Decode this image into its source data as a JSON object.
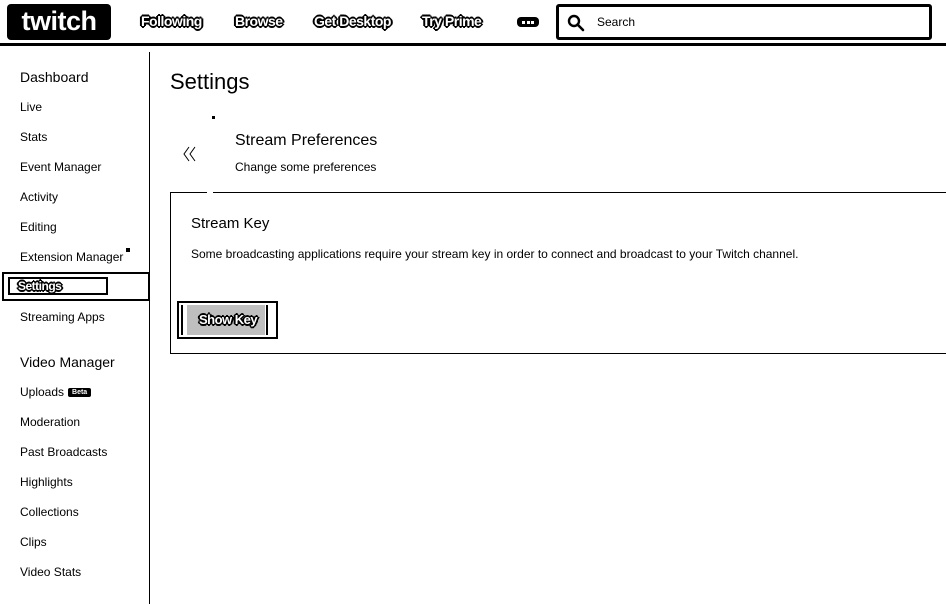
{
  "header": {
    "logo_text": "twitch",
    "nav": [
      {
        "label": "Following"
      },
      {
        "label": "Browse"
      },
      {
        "label": "Get Desktop"
      },
      {
        "label": "Try Prime"
      }
    ],
    "more_icon": "ellipsis-icon",
    "search": {
      "placeholder": "Search",
      "icon": "search-icon"
    }
  },
  "sidebar": {
    "dashboard_heading": "Dashboard",
    "dashboard_items": [
      {
        "label": "Live"
      },
      {
        "label": "Stats"
      },
      {
        "label": "Event Manager"
      },
      {
        "label": "Activity"
      },
      {
        "label": "Editing"
      },
      {
        "label": "Extension Manager"
      },
      {
        "label": "Settings",
        "active": true
      },
      {
        "label": "Streaming Apps"
      }
    ],
    "video_heading": "Video Manager",
    "video_items": [
      {
        "label": "Uploads",
        "badge": "Beta"
      },
      {
        "label": "Moderation"
      },
      {
        "label": "Past Broadcasts"
      },
      {
        "label": "Highlights"
      },
      {
        "label": "Collections"
      },
      {
        "label": "Clips"
      },
      {
        "label": "Video Stats"
      }
    ]
  },
  "main": {
    "title": "Settings",
    "back_icon": "double-chevron-left-icon",
    "preferences": {
      "title": "Stream Preferences",
      "subtitle": "Change some preferences"
    },
    "stream_key": {
      "title": "Stream Key",
      "description": "Some broadcasting applications require your stream key in order to connect and broadcast to your Twitch channel.",
      "button_label": "Show Key"
    }
  }
}
